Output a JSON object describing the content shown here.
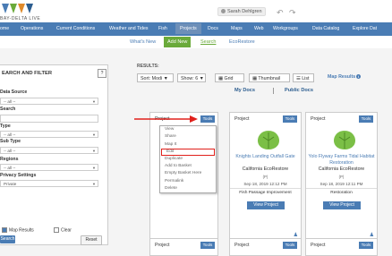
{
  "header": {
    "logo_text": "BAY-DELTA LIVE",
    "user": "Sarah Dehlgren",
    "back_icon": "undo-icon",
    "forward_icon": "redo-icon"
  },
  "nav": {
    "items": [
      "ome",
      "Operations",
      "Current Conditions",
      "Weather and Tides",
      "Fish",
      "Projects",
      "Docs",
      "Maps",
      "Web",
      "Workgroups",
      "Data Catalog",
      "Explore Dat"
    ],
    "active": "Projects"
  },
  "subnav": {
    "whats_new": "What's New",
    "add_new": "Add New",
    "search": "Search",
    "ecorestore": "EcoRestore"
  },
  "sidebar": {
    "title": "EARCH AND FILTER",
    "help": "?",
    "data_source_label": "Data Source",
    "data_source_value": "-- all --",
    "search_label": "Search",
    "type_label": "Type",
    "type_value": "-- all --",
    "sub_type_label": "Sub Type",
    "sub_type_value": "-- all --",
    "regions_label": "Regions",
    "regions_value": "-- all --",
    "privacy_label": "Privacy Settings",
    "privacy_value": "Private",
    "map_results": "Map Results",
    "clear": "Clear",
    "search_button": "Search",
    "reset_button": "Reset"
  },
  "results": {
    "label": "RESULTS:",
    "sort": "Sort: Modi",
    "show": "Show: 6",
    "grid": "Grid",
    "thumbnail": "Thumbnail",
    "list": "List",
    "map_results": "Map Results",
    "my_docs": "My Docs",
    "public_docs": "Public Docs"
  },
  "cards": [
    {
      "label": "Project",
      "tools": "Tools"
    },
    {
      "label": "Project",
      "tools": "Tools",
      "title": "Knights Landing Outfall Gate",
      "subtitle": "California EcoRestore",
      "role": "(P)",
      "date": "Sep 18, 2019 12:12 PM",
      "type": "Fish Passage Improvement",
      "view": "View Project"
    },
    {
      "label": "Project",
      "tools": "Tools",
      "title": "Yolo Flyway Farms Tidal Habitat Restoration",
      "subtitle": "California EcoRestore",
      "role": "(P)",
      "date": "Sep 18, 2019 12:11 PM",
      "type": "Restoration",
      "view": "View Project"
    },
    {
      "label": "Project",
      "tools": "Tools"
    },
    {
      "label": "Project",
      "tools": "Tools"
    },
    {
      "label": "Project",
      "tools": "Tools"
    }
  ],
  "tools_menu": [
    "View",
    "Share",
    "Map It",
    "Edit",
    "Duplicate",
    "Add to Basket",
    "Empty Basket Here",
    "Permalink",
    "Delete"
  ]
}
